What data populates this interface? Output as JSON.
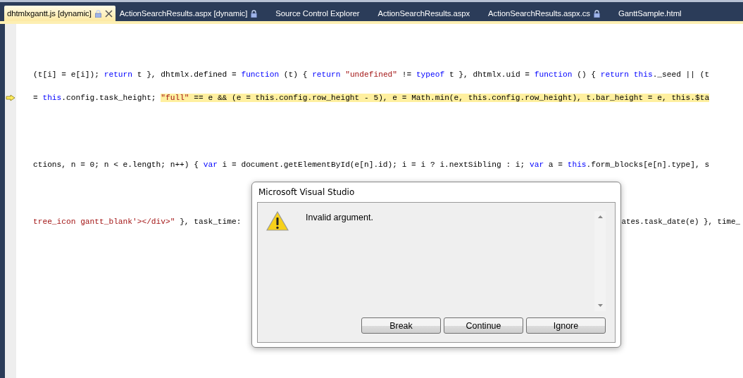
{
  "tabs": [
    {
      "label": "dhtmlxgantt.js [dynamic]",
      "selected": true,
      "locked": true,
      "closable": true
    },
    {
      "label": "ActionSearchResults.aspx [dynamic]",
      "selected": false,
      "locked": true,
      "closable": false
    },
    {
      "label": "Source Control Explorer",
      "selected": false,
      "locked": false,
      "closable": false
    },
    {
      "label": "ActionSearchResults.aspx",
      "selected": false,
      "locked": false,
      "closable": false
    },
    {
      "label": "ActionSearchResults.aspx.cs",
      "selected": false,
      "locked": true,
      "closable": false
    },
    {
      "label": "GanttSample.html",
      "selected": false,
      "locked": false,
      "closable": false
    }
  ],
  "editor": {
    "lines": [
      {
        "current": false,
        "segments": [
          {
            "kind": "plain",
            "text": "(t[i] = e[i]); "
          },
          {
            "kind": "keyword",
            "text": "return"
          },
          {
            "kind": "plain",
            "text": " t }, dhtmlx.defined = "
          },
          {
            "kind": "keyword",
            "text": "function"
          },
          {
            "kind": "plain",
            "text": " (t) { "
          },
          {
            "kind": "keyword",
            "text": "return"
          },
          {
            "kind": "string",
            "text": " \"undefined\""
          },
          {
            "kind": "plain",
            "text": " != "
          },
          {
            "kind": "keyword",
            "text": "typeof"
          },
          {
            "kind": "plain",
            "text": " t }, dhtmlx.uid = "
          },
          {
            "kind": "keyword",
            "text": "function"
          },
          {
            "kind": "plain",
            "text": " () { "
          },
          {
            "kind": "keyword",
            "text": "return this"
          },
          {
            "kind": "plain",
            "text": "._seed || (t"
          }
        ]
      },
      {
        "current": true,
        "segments": [
          {
            "kind": "plain",
            "text": "= "
          },
          {
            "kind": "keyword",
            "text": "this"
          },
          {
            "kind": "plain",
            "text": ".config.task_height; "
          }
        ],
        "highlighted": [
          {
            "kind": "string",
            "text": "\"full\""
          },
          {
            "kind": "plain",
            "text": " == e && (e = this.config.row_height - 5), e = Math.min(e, this.config.row_height), t.bar_height = e, this.$ta"
          }
        ]
      },
      {
        "current": false,
        "segments": [
          {
            "kind": "plain",
            "text": "ctions, n = 0; n < e.length; n++) { "
          },
          {
            "kind": "keyword",
            "text": "var"
          },
          {
            "kind": "plain",
            "text": " i = document.getElementById(e[n].id); i = i ? i.nextSibling : i; "
          },
          {
            "kind": "keyword",
            "text": "var"
          },
          {
            "kind": "plain",
            "text": " a = "
          },
          {
            "kind": "keyword",
            "text": "this"
          },
          {
            "kind": "plain",
            "text": ".form_blocks[e[n].type], s"
          }
        ]
      },
      {
        "current": false,
        "segments": [
          {
            "kind": "string",
            "text": "tree_icon gantt_blank'></div>\""
          },
          {
            "kind": "plain",
            "text": " }, task_time:"
          }
        ],
        "segments_right": [
          {
            "kind": "plain",
            "text": "ates.task_date(e) }, time_"
          }
        ]
      }
    ]
  },
  "dialog": {
    "title": "Microsoft Visual Studio",
    "message": "Invalid argument.",
    "buttons": [
      "Break",
      "Continue",
      "Ignore"
    ]
  }
}
